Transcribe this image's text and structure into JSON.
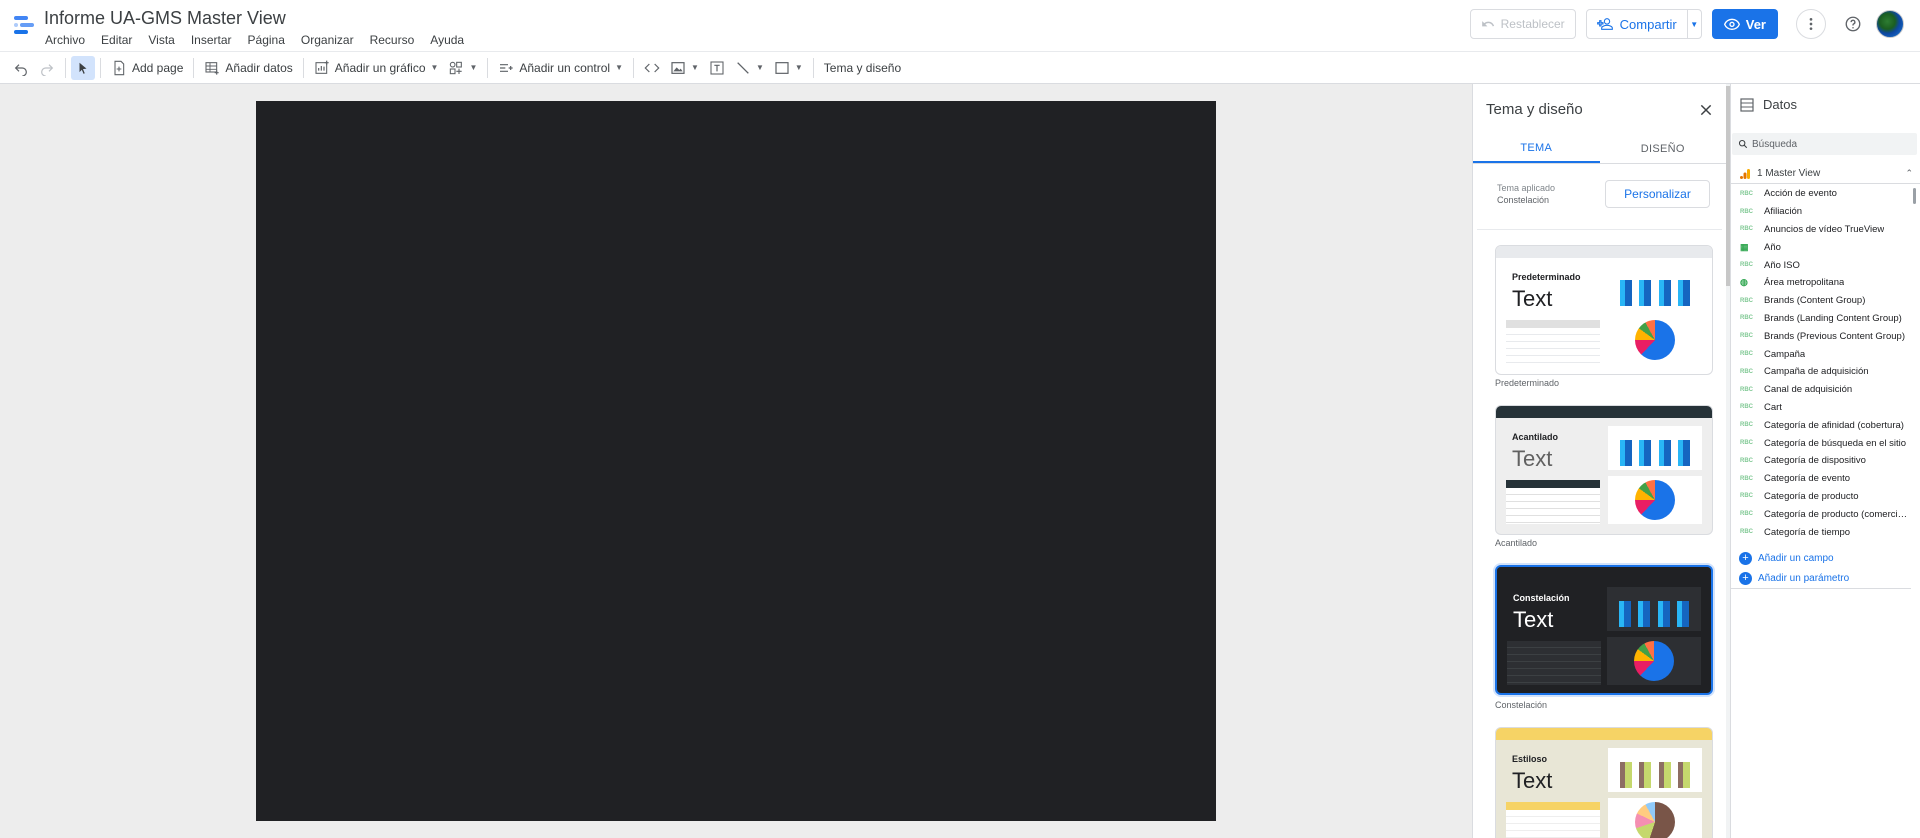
{
  "header": {
    "title": "Informe UA-GMS Master View",
    "menu": [
      "Archivo",
      "Editar",
      "Vista",
      "Insertar",
      "Página",
      "Organizar",
      "Recurso",
      "Ayuda"
    ],
    "reset_label": "Restablecer",
    "share_label": "Compartir",
    "view_label": "Ver"
  },
  "toolbar": {
    "add_page": "Add page",
    "add_data": "Añadir datos",
    "add_chart": "Añadir un gráfico",
    "add_control": "Añadir un control",
    "theme_layout": "Tema y diseño"
  },
  "theme_panel": {
    "title": "Tema y diseño",
    "tabs": [
      "TEMA",
      "DISEÑO"
    ],
    "applied_label": "Tema aplicado",
    "applied_value": "Constelación",
    "customize_label": "Personalizar",
    "themes": [
      {
        "name": "Predeterminado",
        "caption": "Predeterminado",
        "sample": "Text"
      },
      {
        "name": "Acantilado",
        "caption": "Acantilado",
        "sample": "Text"
      },
      {
        "name": "Constelación",
        "caption": "Constelación",
        "sample": "Text"
      },
      {
        "name": "Estiloso",
        "caption": "",
        "sample": "Text"
      }
    ]
  },
  "data_panel": {
    "title": "Datos",
    "search_placeholder": "Búsqueda",
    "source": "1 Master View",
    "fields": [
      {
        "label": "Acción de evento",
        "type": "ABC"
      },
      {
        "label": "Afiliación",
        "type": "ABC"
      },
      {
        "label": "Anuncios de vídeo TrueView",
        "type": "ABC"
      },
      {
        "label": "Año",
        "type": "calendar"
      },
      {
        "label": "Año ISO",
        "type": "ABC"
      },
      {
        "label": "Área metropolitana",
        "type": "geo"
      },
      {
        "label": "Brands (Content Group)",
        "type": "ABC"
      },
      {
        "label": "Brands (Landing Content Group)",
        "type": "ABC"
      },
      {
        "label": "Brands (Previous Content Group)",
        "type": "ABC"
      },
      {
        "label": "Campaña",
        "type": "ABC"
      },
      {
        "label": "Campaña de adquisición",
        "type": "ABC"
      },
      {
        "label": "Canal de adquisición",
        "type": "ABC"
      },
      {
        "label": "Cart",
        "type": "ABC"
      },
      {
        "label": "Categoría de afinidad (cobertura)",
        "type": "ABC"
      },
      {
        "label": "Categoría de búsqueda en el sitio",
        "type": "ABC"
      },
      {
        "label": "Categoría de dispositivo",
        "type": "ABC"
      },
      {
        "label": "Categoría de evento",
        "type": "ABC"
      },
      {
        "label": "Categoría de producto",
        "type": "ABC"
      },
      {
        "label": "Categoría de producto (comercio electrónico mejorado)",
        "type": "ABC"
      },
      {
        "label": "Categoría de tiempo",
        "type": "ABC"
      }
    ],
    "add_field": "Añadir un campo",
    "add_parameter": "Añadir un parámetro"
  },
  "colors": {
    "accent": "#1a73e8",
    "canvas_bg": "#ededed",
    "page_bg": "#202124"
  }
}
